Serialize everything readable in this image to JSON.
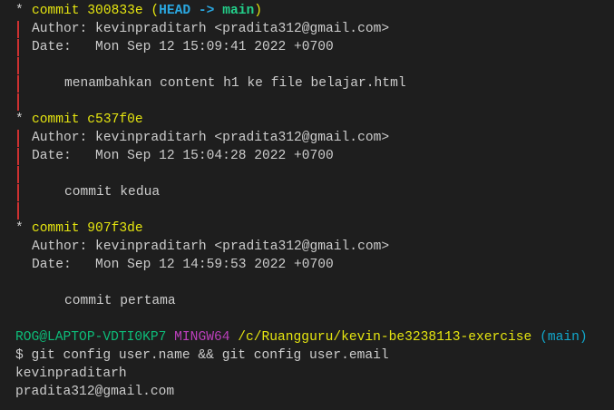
{
  "colors": {
    "background": "#1e1e1e",
    "text": "#cccccc",
    "commit": "#e5e510",
    "head": "#2aa7e0",
    "branch": "#23d18b",
    "graph": "#cd3131",
    "user": "#0dbc79",
    "shell": "#bc3fbc",
    "path": "#e5e510",
    "prompt_branch": "#11a8cd"
  },
  "commits": [
    {
      "hash_line": "commit 300833e",
      "ref_open": " (",
      "head": "HEAD ->",
      "branch": " main",
      "ref_close": ")",
      "author": "Author: kevinpraditarh <pradita312@gmail.com>",
      "date": "Date:   Mon Sep 12 15:09:41 2022 +0700",
      "message": "menambahkan content h1 ke file belajar.html"
    },
    {
      "hash_line": "commit c537f0e",
      "author": "Author: kevinpraditarh <pradita312@gmail.com>",
      "date": "Date:   Mon Sep 12 15:04:28 2022 +0700",
      "message": "commit kedua"
    },
    {
      "hash_line": "commit 907f3de",
      "author": "Author: kevinpraditarh <pradita312@gmail.com>",
      "date": "Date:   Mon Sep 12 14:59:53 2022 +0700",
      "message": "commit pertama"
    }
  ],
  "graph_star": "*",
  "prompt": {
    "user_host": "ROG@LAPTOP-VDTI0KP7",
    "shell": "MINGW64",
    "path": "/c/Ruangguru/kevin-be3238113-exercise",
    "branch": "(main)"
  },
  "command": "$ git config user.name && git config user.email",
  "output": [
    "kevinpraditarh",
    "pradita312@gmail.com"
  ]
}
